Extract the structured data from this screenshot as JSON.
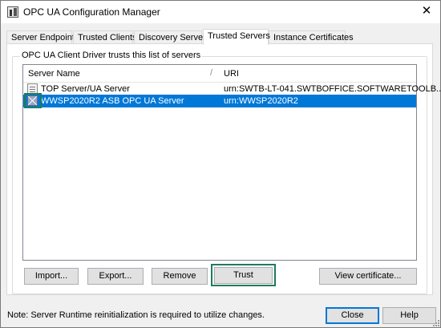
{
  "window": {
    "title": "OPC UA Configuration Manager",
    "close_symbol": "✕"
  },
  "tabs": [
    {
      "label": "Server Endpoints"
    },
    {
      "label": "Trusted Clients"
    },
    {
      "label": "Discovery Servers"
    },
    {
      "label": "Trusted Servers",
      "selected": true
    },
    {
      "label": "Instance Certificates"
    }
  ],
  "group": {
    "caption": "OPC UA Client Driver trusts this list of servers"
  },
  "list": {
    "columns": [
      "Server Name",
      "URI"
    ],
    "divider": "/",
    "rows": [
      {
        "icon": "trusted-server-icon",
        "name": "TOP Server/UA Server",
        "uri": "urn:SWTB-LT-041.SWTBOFFICE.SOFTWARETOOLB..."
      },
      {
        "icon": "untrusted-server-icon",
        "name": "WWSP2020R2 ASB OPC UA Server",
        "uri": "urn:WWSP2020R2",
        "selected": true
      }
    ]
  },
  "buttons": {
    "import": "Import...",
    "export": "Export...",
    "remove": "Remove",
    "trust": "Trust",
    "view_certificate": "View certificate..."
  },
  "footer": {
    "note": "Note: Server Runtime reinitialization is required to utilize changes.",
    "close": "Close",
    "help": "Help"
  },
  "colors": {
    "selection": "#0078d7",
    "highlight_frame": "#1e7b5c"
  }
}
